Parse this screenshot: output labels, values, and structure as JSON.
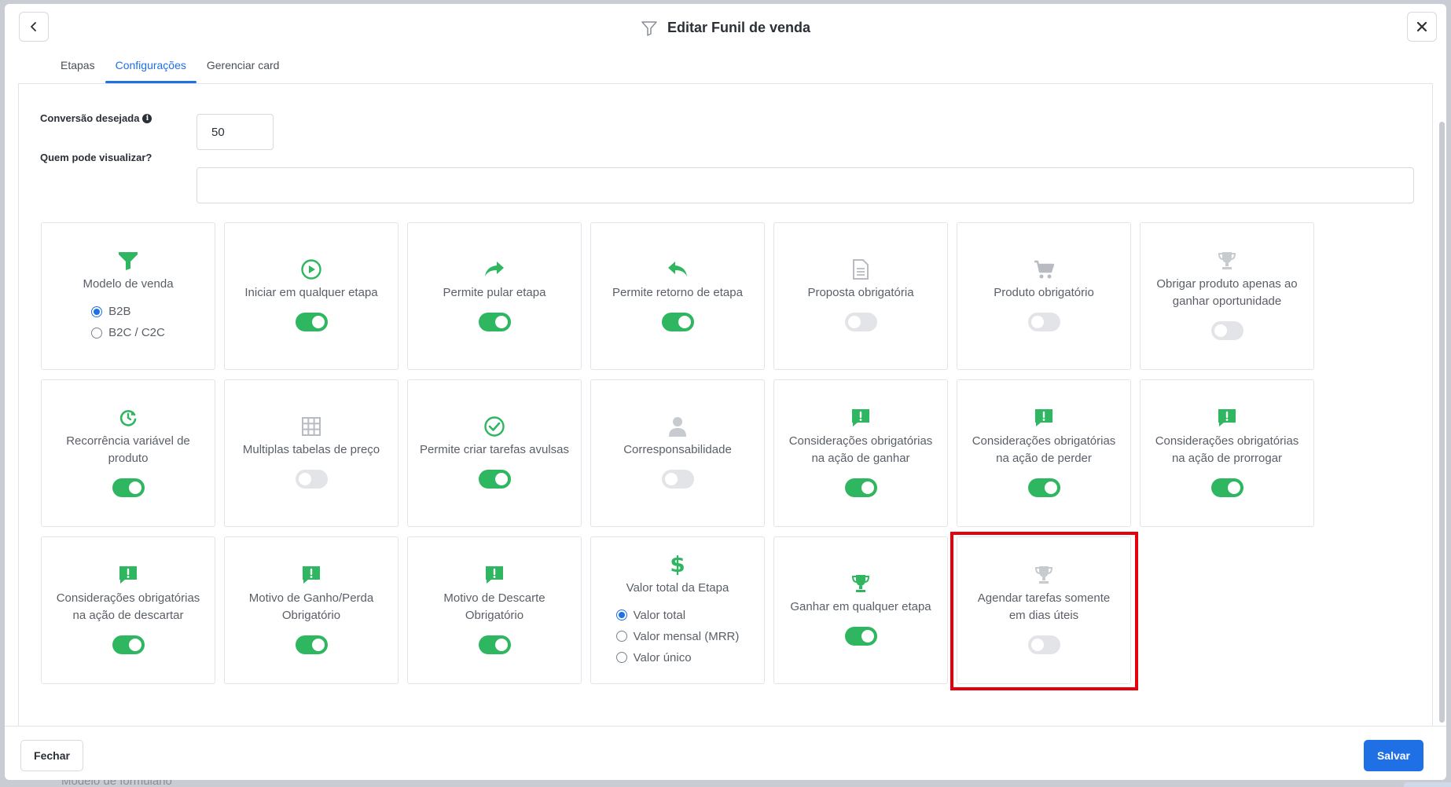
{
  "header": {
    "title": "Editar Funil de venda"
  },
  "tabs": [
    {
      "label": "Etapas",
      "active": false
    },
    {
      "label": "Configurações",
      "active": true
    },
    {
      "label": "Gerenciar card",
      "active": false
    }
  ],
  "form": {
    "conversion_label": "Conversão desejada",
    "conversion_value": "50",
    "viewers_label": "Quem pode visualizar?",
    "viewers_value": ""
  },
  "cards": {
    "modelo": {
      "label": "Modelo de venda",
      "options": [
        "B2B",
        "B2C / C2C"
      ],
      "selected": "B2B"
    },
    "iniciar": {
      "label": "Iniciar em qualquer etapa",
      "on": true
    },
    "pular": {
      "label": "Permite pular etapa",
      "on": true
    },
    "retorno": {
      "label": "Permite retorno de etapa",
      "on": true
    },
    "proposta": {
      "label": "Proposta obrigatória",
      "on": false
    },
    "produto": {
      "label": "Produto obrigatório",
      "on": false
    },
    "produto_ganhar": {
      "label": "Obrigar produto apenas ao ganhar oportunidade",
      "on": false
    },
    "recorrencia": {
      "label": "Recorrência variável de produto",
      "on": true
    },
    "tabelas": {
      "label": "Multiplas tabelas de preço",
      "on": false
    },
    "tarefas": {
      "label": "Permite criar tarefas avulsas",
      "on": true
    },
    "corresp": {
      "label": "Corresponsabilidade",
      "on": false
    },
    "consid_ganhar": {
      "label": "Considerações obrigatórias na ação de ganhar",
      "on": true
    },
    "consid_perder": {
      "label": "Considerações obrigatórias na ação de perder",
      "on": true
    },
    "consid_prorrogar": {
      "label": "Considerações obrigatórias na ação de prorrogar",
      "on": true
    },
    "consid_descartar": {
      "label": "Considerações obrigatórias na ação de descartar",
      "on": true
    },
    "motivo_ganho": {
      "label": "Motivo de Ganho/Perda Obrigatório",
      "on": true
    },
    "motivo_descarte": {
      "label": "Motivo de Descarte Obrigatório",
      "on": true
    },
    "valor_total": {
      "label": "Valor total da Etapa",
      "options": [
        "Valor total",
        "Valor mensal (MRR)",
        "Valor único"
      ],
      "selected": "Valor total"
    },
    "ganhar_qualquer": {
      "label": "Ganhar em qualquer etapa",
      "on": true
    },
    "agendar": {
      "label": "Agendar tarefas somente em dias úteis",
      "on": false
    }
  },
  "footer": {
    "close_label": "Fechar",
    "save_label": "Salvar"
  },
  "background": {
    "text": "Modelo de formulário"
  },
  "colors": {
    "accent": "#1f6fe5",
    "toggle_on": "#2fb660",
    "icon_active": "#2fb660",
    "icon_inactive": "#b8bcc2",
    "highlight": "#e5000b"
  }
}
